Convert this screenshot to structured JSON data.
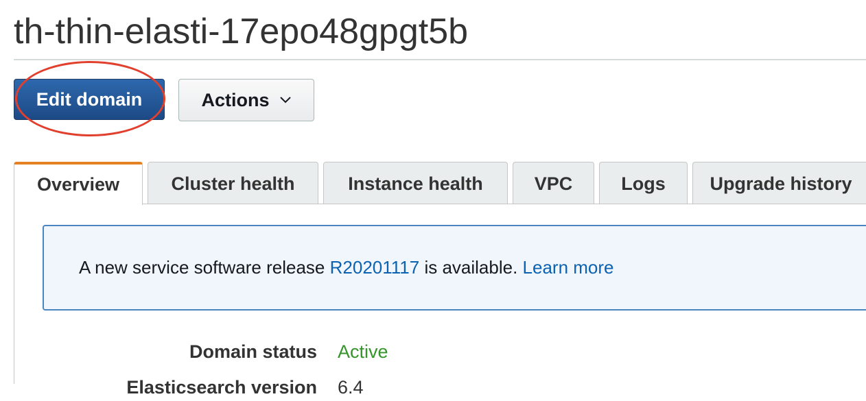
{
  "page": {
    "title": "th-thin-elasti-17epo48gpgt5b"
  },
  "toolbar": {
    "edit_domain_label": "Edit domain",
    "actions_label": "Actions",
    "actions_icon": "chevron-down-icon",
    "highlight_color": "#e2402e"
  },
  "tabs": [
    {
      "label": "Overview",
      "active": true
    },
    {
      "label": "Cluster health",
      "active": false
    },
    {
      "label": "Instance health",
      "active": false
    },
    {
      "label": "VPC",
      "active": false
    },
    {
      "label": "Logs",
      "active": false
    },
    {
      "label": "Upgrade history",
      "active": false
    }
  ],
  "alert": {
    "text_before": "A new service software release ",
    "release_link": "R20201117",
    "text_after": " is available. ",
    "learn_more_link": "Learn more"
  },
  "details": [
    {
      "label": "Domain status",
      "value": "Active",
      "value_color": "#35952b"
    },
    {
      "label": "Elasticsearch version",
      "value": "6.4"
    }
  ],
  "colors": {
    "primary_button": "#1d4a86",
    "active_tab_accent": "#e48223",
    "link": "#0b62b0",
    "alert_border": "#4a85c2"
  }
}
